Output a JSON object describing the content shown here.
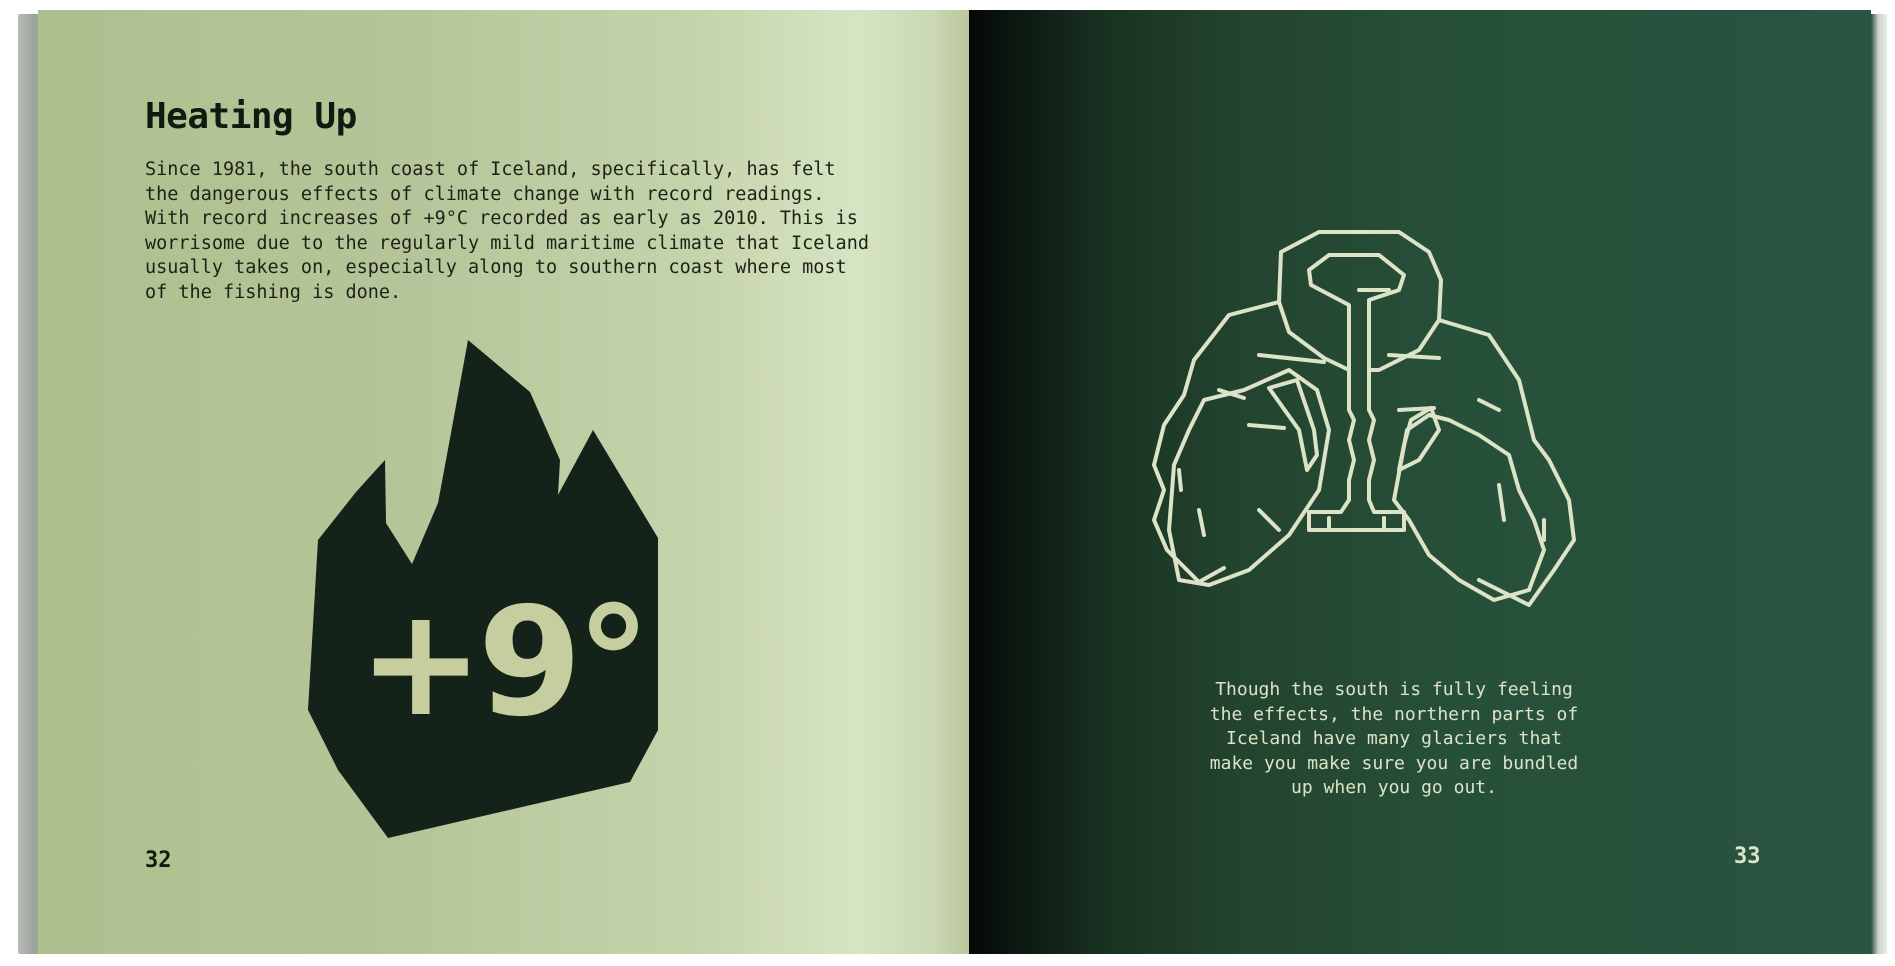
{
  "left_page": {
    "heading": "Heating Up",
    "body": "Since 1981, the south coast of Iceland, specifically, has felt\nthe dangerous effects of climate change with record readings.\nWith record increases of +9°C recorded as early as 2010. This is\nworrisome due to the regularly mild maritime climate that Iceland\nusually takes on, especially along to southern coast where most\nof the fishing is done.",
    "flame_label": "+9°",
    "page_number": "32"
  },
  "right_page": {
    "caption": "Though the south is fully feeling\nthe effects, the northern parts of\nIceland have many glaciers that\nmake you make sure you are bundled\nup when you go out.",
    "page_number": "33"
  },
  "icons": {
    "flame": "flame-icon",
    "jacket": "puffer-jacket-icon"
  },
  "colors": {
    "left_page_bg": "#b6c599",
    "right_page_bg": "#27503a",
    "flame_fill": "#13231a",
    "flame_text": "#c6cd9e",
    "jacket_stroke": "#dde3c7"
  }
}
